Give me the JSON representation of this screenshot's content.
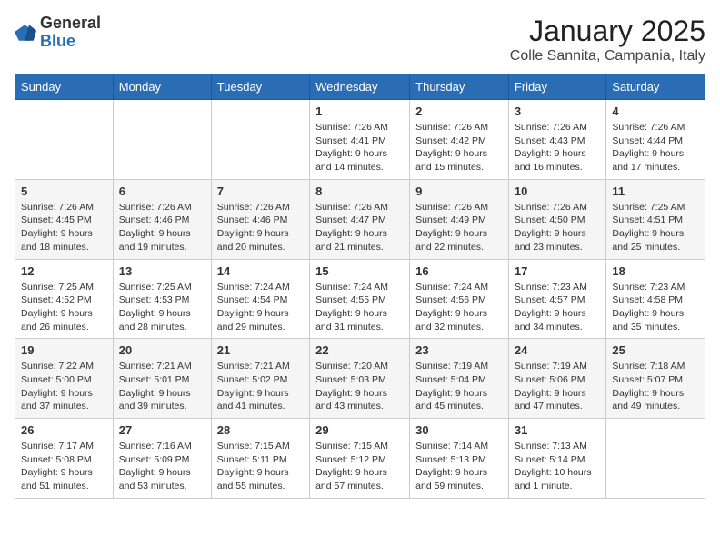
{
  "logo": {
    "general": "General",
    "blue": "Blue"
  },
  "header": {
    "month_year": "January 2025",
    "location": "Colle Sannita, Campania, Italy"
  },
  "weekdays": [
    "Sunday",
    "Monday",
    "Tuesday",
    "Wednesday",
    "Thursday",
    "Friday",
    "Saturday"
  ],
  "weeks": [
    [
      {
        "day": "",
        "info": ""
      },
      {
        "day": "",
        "info": ""
      },
      {
        "day": "",
        "info": ""
      },
      {
        "day": "1",
        "info": "Sunrise: 7:26 AM\nSunset: 4:41 PM\nDaylight: 9 hours and 14 minutes."
      },
      {
        "day": "2",
        "info": "Sunrise: 7:26 AM\nSunset: 4:42 PM\nDaylight: 9 hours and 15 minutes."
      },
      {
        "day": "3",
        "info": "Sunrise: 7:26 AM\nSunset: 4:43 PM\nDaylight: 9 hours and 16 minutes."
      },
      {
        "day": "4",
        "info": "Sunrise: 7:26 AM\nSunset: 4:44 PM\nDaylight: 9 hours and 17 minutes."
      }
    ],
    [
      {
        "day": "5",
        "info": "Sunrise: 7:26 AM\nSunset: 4:45 PM\nDaylight: 9 hours and 18 minutes."
      },
      {
        "day": "6",
        "info": "Sunrise: 7:26 AM\nSunset: 4:46 PM\nDaylight: 9 hours and 19 minutes."
      },
      {
        "day": "7",
        "info": "Sunrise: 7:26 AM\nSunset: 4:46 PM\nDaylight: 9 hours and 20 minutes."
      },
      {
        "day": "8",
        "info": "Sunrise: 7:26 AM\nSunset: 4:47 PM\nDaylight: 9 hours and 21 minutes."
      },
      {
        "day": "9",
        "info": "Sunrise: 7:26 AM\nSunset: 4:49 PM\nDaylight: 9 hours and 22 minutes."
      },
      {
        "day": "10",
        "info": "Sunrise: 7:26 AM\nSunset: 4:50 PM\nDaylight: 9 hours and 23 minutes."
      },
      {
        "day": "11",
        "info": "Sunrise: 7:25 AM\nSunset: 4:51 PM\nDaylight: 9 hours and 25 minutes."
      }
    ],
    [
      {
        "day": "12",
        "info": "Sunrise: 7:25 AM\nSunset: 4:52 PM\nDaylight: 9 hours and 26 minutes."
      },
      {
        "day": "13",
        "info": "Sunrise: 7:25 AM\nSunset: 4:53 PM\nDaylight: 9 hours and 28 minutes."
      },
      {
        "day": "14",
        "info": "Sunrise: 7:24 AM\nSunset: 4:54 PM\nDaylight: 9 hours and 29 minutes."
      },
      {
        "day": "15",
        "info": "Sunrise: 7:24 AM\nSunset: 4:55 PM\nDaylight: 9 hours and 31 minutes."
      },
      {
        "day": "16",
        "info": "Sunrise: 7:24 AM\nSunset: 4:56 PM\nDaylight: 9 hours and 32 minutes."
      },
      {
        "day": "17",
        "info": "Sunrise: 7:23 AM\nSunset: 4:57 PM\nDaylight: 9 hours and 34 minutes."
      },
      {
        "day": "18",
        "info": "Sunrise: 7:23 AM\nSunset: 4:58 PM\nDaylight: 9 hours and 35 minutes."
      }
    ],
    [
      {
        "day": "19",
        "info": "Sunrise: 7:22 AM\nSunset: 5:00 PM\nDaylight: 9 hours and 37 minutes."
      },
      {
        "day": "20",
        "info": "Sunrise: 7:21 AM\nSunset: 5:01 PM\nDaylight: 9 hours and 39 minutes."
      },
      {
        "day": "21",
        "info": "Sunrise: 7:21 AM\nSunset: 5:02 PM\nDaylight: 9 hours and 41 minutes."
      },
      {
        "day": "22",
        "info": "Sunrise: 7:20 AM\nSunset: 5:03 PM\nDaylight: 9 hours and 43 minutes."
      },
      {
        "day": "23",
        "info": "Sunrise: 7:19 AM\nSunset: 5:04 PM\nDaylight: 9 hours and 45 minutes."
      },
      {
        "day": "24",
        "info": "Sunrise: 7:19 AM\nSunset: 5:06 PM\nDaylight: 9 hours and 47 minutes."
      },
      {
        "day": "25",
        "info": "Sunrise: 7:18 AM\nSunset: 5:07 PM\nDaylight: 9 hours and 49 minutes."
      }
    ],
    [
      {
        "day": "26",
        "info": "Sunrise: 7:17 AM\nSunset: 5:08 PM\nDaylight: 9 hours and 51 minutes."
      },
      {
        "day": "27",
        "info": "Sunrise: 7:16 AM\nSunset: 5:09 PM\nDaylight: 9 hours and 53 minutes."
      },
      {
        "day": "28",
        "info": "Sunrise: 7:15 AM\nSunset: 5:11 PM\nDaylight: 9 hours and 55 minutes."
      },
      {
        "day": "29",
        "info": "Sunrise: 7:15 AM\nSunset: 5:12 PM\nDaylight: 9 hours and 57 minutes."
      },
      {
        "day": "30",
        "info": "Sunrise: 7:14 AM\nSunset: 5:13 PM\nDaylight: 9 hours and 59 minutes."
      },
      {
        "day": "31",
        "info": "Sunrise: 7:13 AM\nSunset: 5:14 PM\nDaylight: 10 hours and 1 minute."
      },
      {
        "day": "",
        "info": ""
      }
    ]
  ]
}
